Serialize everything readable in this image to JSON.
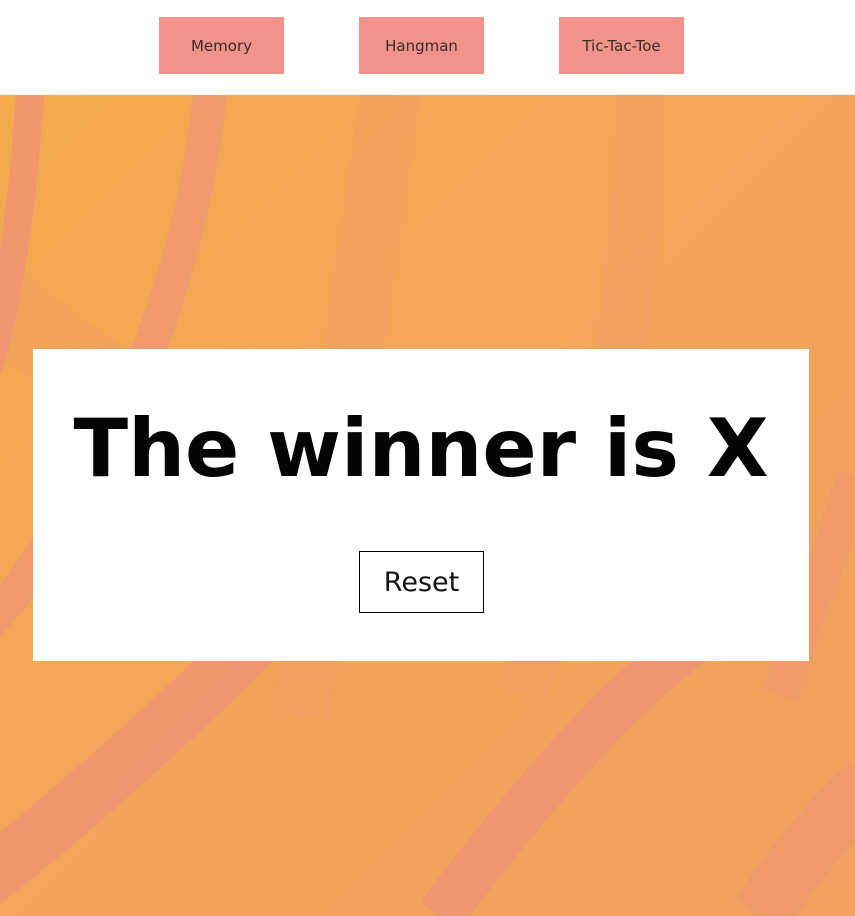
{
  "nav": {
    "items": [
      {
        "label": "Memory"
      },
      {
        "label": "Hangman"
      },
      {
        "label": "Tic-Tac-Toe"
      }
    ]
  },
  "result": {
    "message": "The winner is X",
    "reset_label": "Reset"
  },
  "colors": {
    "nav_button_bg": "#f1938b",
    "background_orange": "#f4aa4d",
    "arc_salmon": "#ef9474",
    "card_bg": "#ffffff"
  }
}
